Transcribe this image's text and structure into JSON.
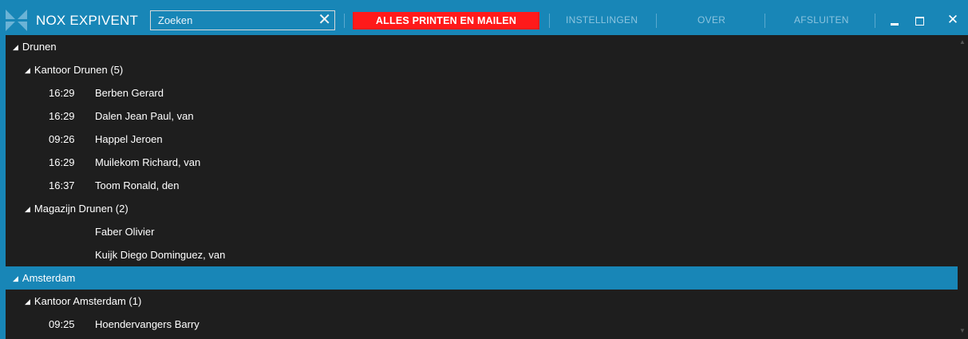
{
  "app": {
    "title": "NOX EXPIVENT"
  },
  "search": {
    "value": "Zoeken",
    "clear_glyph": "✕"
  },
  "toolbar": {
    "print_label": "ALLES PRINTEN EN MAILEN",
    "settings_label": "INSTELLINGEN",
    "about_label": "OVER",
    "exit_label": "AFSLUITEN"
  },
  "window": {
    "minimize_glyph": "▁",
    "maximize_glyph": "▭",
    "close_glyph": "✕"
  },
  "tree": {
    "groups": [
      {
        "label": "Drunen",
        "departments": [
          {
            "label": "Kantoor Drunen  (5)",
            "people": [
              {
                "time": "16:29",
                "name": "Berben Gerard"
              },
              {
                "time": "16:29",
                "name": "Dalen Jean Paul, van"
              },
              {
                "time": "09:26",
                "name": "Happel Jeroen"
              },
              {
                "time": "16:29",
                "name": "Muilekom Richard, van"
              },
              {
                "time": "16:37",
                "name": "Toom Ronald, den"
              }
            ]
          },
          {
            "label": "Magazijn Drunen  (2)",
            "people": [
              {
                "time": "",
                "name": "Faber Olivier"
              },
              {
                "time": "",
                "name": "Kuijk Diego Dominguez, van"
              }
            ]
          }
        ]
      },
      {
        "label": "Amsterdam",
        "selected": true,
        "departments": [
          {
            "label": "Kantoor Amsterdam  (1)",
            "people": [
              {
                "time": "09:25",
                "name": "Hoendervangers Barry"
              }
            ]
          }
        ]
      }
    ]
  },
  "colors": {
    "accent": "#1886b7",
    "print_button": "#ff1a1a",
    "background": "#1e1e1e"
  }
}
